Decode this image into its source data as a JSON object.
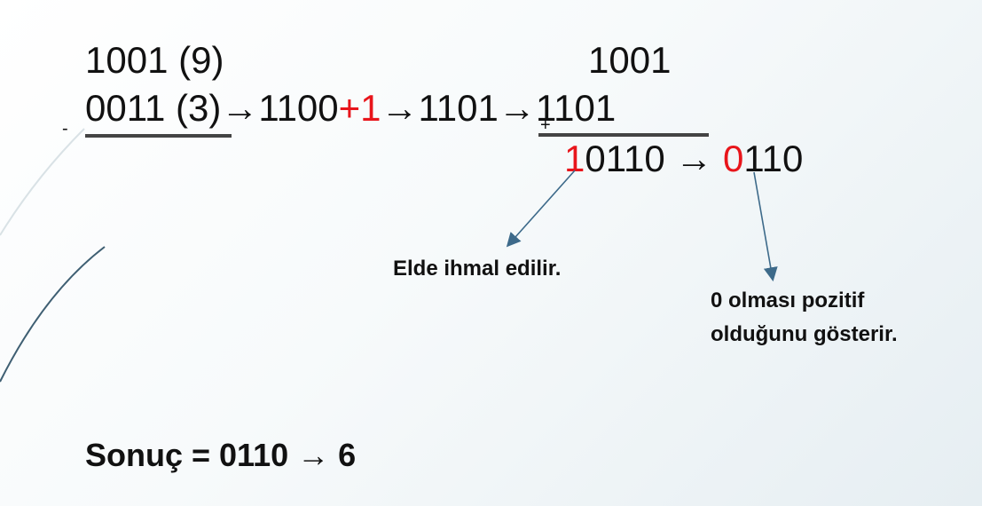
{
  "left": {
    "minuend": "1001 (9)",
    "subtrahend": "0011 (3)",
    "operator": "-"
  },
  "chain": {
    "arrow": "→",
    "ones_complement": "1100",
    "plus_one": "+1",
    "twos_complement": "1101"
  },
  "right": {
    "top": "1001",
    "bottom": "1101",
    "operator": "+",
    "carry_digit": "1",
    "sum_rest": "0110",
    "arrow": "→",
    "sign_bit": "0",
    "result_rest": "110"
  },
  "notes": {
    "carry_note": "Elde ihmal edilir.",
    "sign_note_line1": "0 olması pozitif",
    "sign_note_line2": "olduğunu gösterir."
  },
  "footer": {
    "result_text": "Sonuç = 0110 → 6"
  },
  "colors": {
    "accent_red": "#e8151b",
    "arrow_blue": "#3d6a8a",
    "rule_gray": "#444444"
  }
}
